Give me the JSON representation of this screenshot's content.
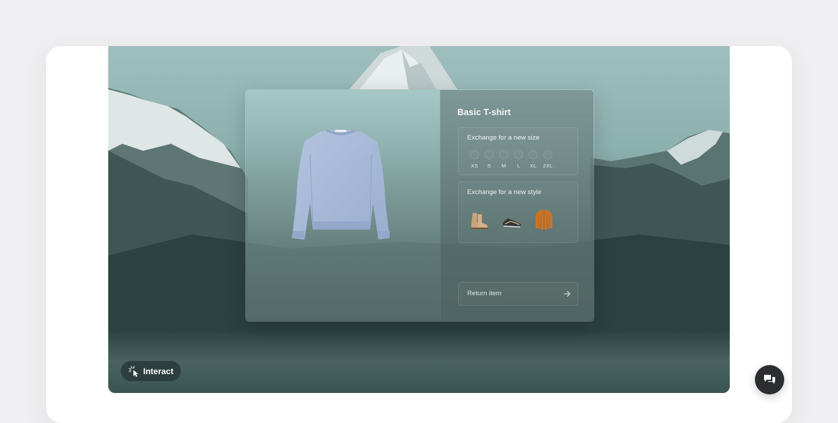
{
  "product": {
    "title": "Basic T-shirt",
    "image_icon": "sweater-image"
  },
  "size_exchange": {
    "label": "Exchange for a new size",
    "sizes": [
      "XS",
      "S",
      "M",
      "L",
      "XL",
      "2XL"
    ]
  },
  "style_exchange": {
    "label": "Exchange for a new style",
    "options": [
      "boots-icon",
      "sneaker-icon",
      "jacket-icon"
    ]
  },
  "return": {
    "label": "Return item",
    "icon": "arrow-right-icon"
  },
  "interact": {
    "label": "Interact",
    "icon": "pointer-click-icon"
  },
  "chat": {
    "icon": "chat-icon"
  },
  "colors": {
    "page_bg": "#efeff1",
    "card_bg": "#ffffff",
    "chat_button": "#2b2d30",
    "sweater": "#a9bcd9"
  }
}
